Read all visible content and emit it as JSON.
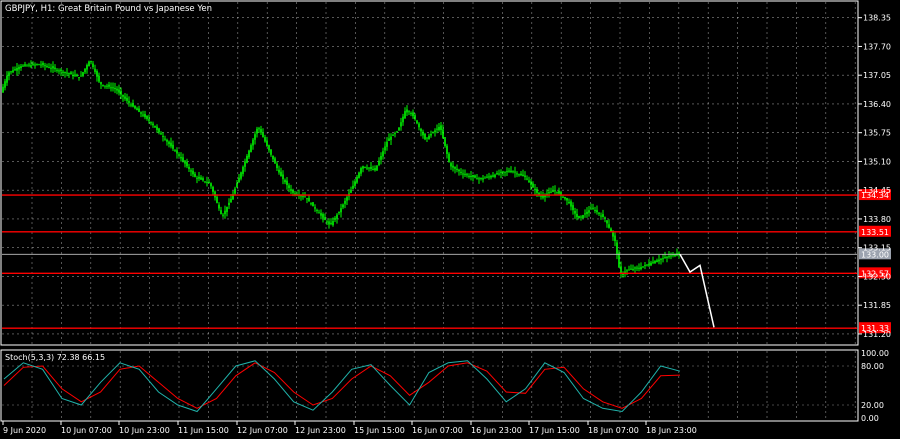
{
  "window": {
    "title": "GBPJPY, H1:  Great Britain Pound vs Japanese Yen"
  },
  "colors": {
    "background": "#000000",
    "grid": "#ffffff",
    "candles": "#00ff00",
    "level_lines": "#ff0000",
    "level_label_bg": "#ff0000",
    "current_price_line": "#c0c0c0",
    "projection": "#ffffff",
    "stoch_main": "#20b2aa",
    "stoch_signal": "#ff0000"
  },
  "price_axis": {
    "ticks": [
      "138.35",
      "137.70",
      "137.05",
      "136.40",
      "135.75",
      "135.10",
      "134.45",
      "133.80",
      "133.15",
      "132.50",
      "131.85",
      "131.20"
    ]
  },
  "level_lines": [
    {
      "label": "134.34",
      "value": 134.34
    },
    {
      "label": "133.51",
      "value": 133.51
    },
    {
      "label": "132.57",
      "value": 132.57
    },
    {
      "label": "131.33",
      "value": 131.33
    }
  ],
  "current_price": {
    "label": "133.00",
    "value": 133.0
  },
  "time_axis": {
    "ticks": [
      "9 Jun 2020",
      "10 Jun 07:00",
      "10 Jun 23:00",
      "11 Jun 15:00",
      "12 Jun 07:00",
      "12 Jun 23:00",
      "15 Jun 15:00",
      "16 Jun 07:00",
      "16 Jun 23:00",
      "17 Jun 15:00",
      "18 Jun 07:00",
      "18 Jun 23:00"
    ]
  },
  "stochastic": {
    "header": "Stoch(5,3,3) 72.38 66.15",
    "ticks": [
      "100.00",
      "80.00",
      "20.00",
      "0.00"
    ]
  },
  "chart_data": {
    "type": "candlestick",
    "symbol": "GBPJPY",
    "timeframe": "H1",
    "ylim": [
      130.95,
      138.75
    ],
    "approximate_close_path": [
      [
        0,
        136.6
      ],
      [
        8,
        137.1
      ],
      [
        20,
        137.25
      ],
      [
        40,
        137.3
      ],
      [
        60,
        137.15
      ],
      [
        80,
        137.0
      ],
      [
        90,
        137.4
      ],
      [
        100,
        136.85
      ],
      [
        115,
        136.75
      ],
      [
        130,
        136.4
      ],
      [
        150,
        136.0
      ],
      [
        165,
        135.6
      ],
      [
        180,
        135.2
      ],
      [
        195,
        134.75
      ],
      [
        210,
        134.6
      ],
      [
        222,
        133.85
      ],
      [
        232,
        134.3
      ],
      [
        245,
        135.1
      ],
      [
        258,
        135.9
      ],
      [
        270,
        135.3
      ],
      [
        280,
        134.8
      ],
      [
        292,
        134.4
      ],
      [
        305,
        134.3
      ],
      [
        320,
        133.9
      ],
      [
        330,
        133.65
      ],
      [
        340,
        134.0
      ],
      [
        352,
        134.5
      ],
      [
        362,
        135.0
      ],
      [
        375,
        134.9
      ],
      [
        388,
        135.6
      ],
      [
        398,
        135.8
      ],
      [
        406,
        136.3
      ],
      [
        414,
        136.1
      ],
      [
        425,
        135.6
      ],
      [
        440,
        135.9
      ],
      [
        450,
        135.0
      ],
      [
        465,
        134.8
      ],
      [
        480,
        134.7
      ],
      [
        495,
        134.8
      ],
      [
        510,
        134.9
      ],
      [
        525,
        134.75
      ],
      [
        540,
        134.3
      ],
      [
        555,
        134.45
      ],
      [
        568,
        134.2
      ],
      [
        578,
        133.8
      ],
      [
        592,
        134.05
      ],
      [
        605,
        133.8
      ],
      [
        615,
        133.3
      ],
      [
        620,
        132.55
      ],
      [
        628,
        132.65
      ],
      [
        640,
        132.7
      ],
      [
        655,
        132.85
      ],
      [
        668,
        132.95
      ],
      [
        680,
        133.05
      ]
    ],
    "projection_path": [
      [
        680,
        133.0
      ],
      [
        690,
        132.6
      ],
      [
        700,
        132.75
      ],
      [
        714,
        131.35
      ]
    ],
    "stoch_main_sample": [
      60,
      85,
      75,
      30,
      20,
      55,
      85,
      75,
      40,
      20,
      10,
      45,
      80,
      88,
      60,
      25,
      12,
      40,
      75,
      82,
      50,
      20,
      70,
      85,
      88,
      60,
      25,
      45,
      85,
      70,
      30,
      15,
      10,
      40,
      80,
      72
    ],
    "stoch_signal_sample": [
      50,
      78,
      80,
      45,
      25,
      40,
      75,
      80,
      55,
      30,
      15,
      30,
      65,
      85,
      70,
      40,
      20,
      30,
      60,
      80,
      65,
      35,
      55,
      80,
      85,
      72,
      40,
      38,
      75,
      78,
      45,
      25,
      15,
      30,
      65,
      66
    ]
  }
}
